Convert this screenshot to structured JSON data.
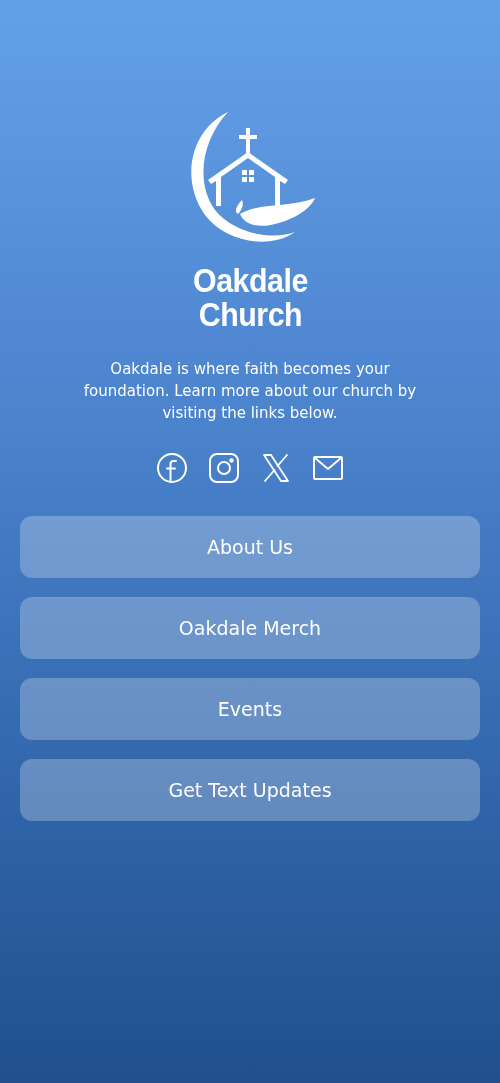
{
  "brand": {
    "name": "Oakdale\nChurch"
  },
  "description": "Oakdale is where faith becomes your foundation. Learn more about our church by visiting the links below.",
  "social_links": [
    {
      "kind": "facebook"
    },
    {
      "kind": "instagram"
    },
    {
      "kind": "x"
    },
    {
      "kind": "email"
    }
  ],
  "links": [
    "About Us",
    "Oakdale Merch",
    "Events",
    "Get Text Updates"
  ]
}
